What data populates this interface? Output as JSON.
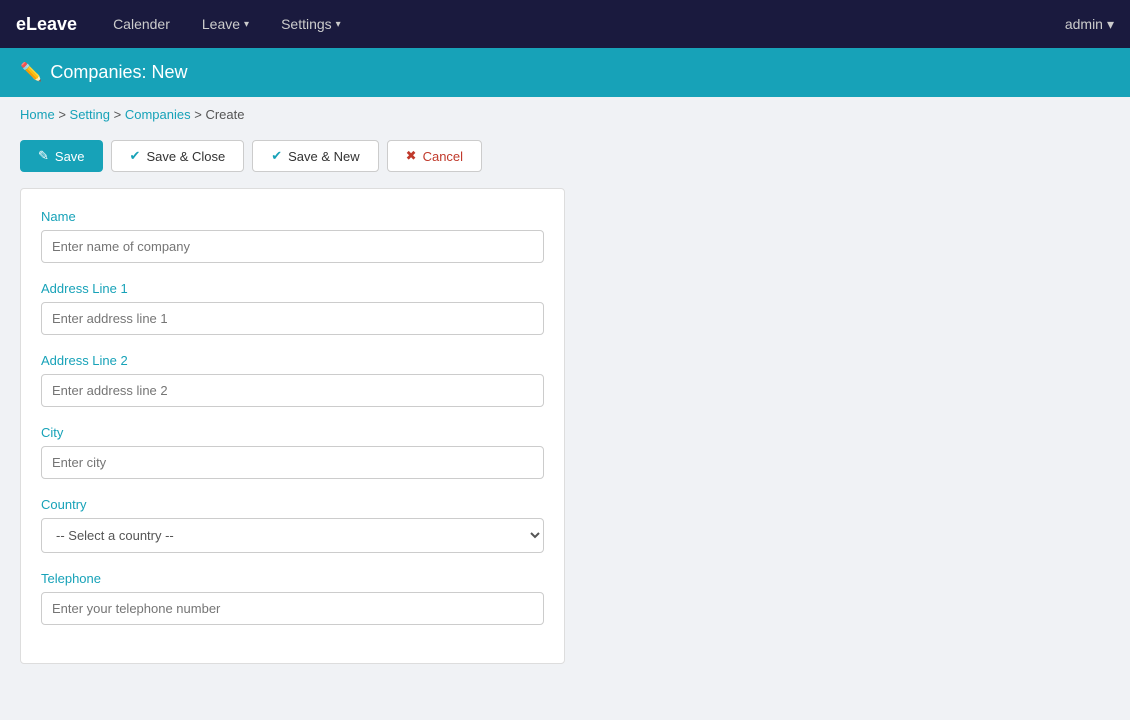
{
  "navbar": {
    "brand": "eLeave",
    "nav_items": [
      {
        "label": "Calender",
        "has_dropdown": false
      },
      {
        "label": "Leave",
        "has_dropdown": true
      },
      {
        "label": "Settings",
        "has_dropdown": true
      }
    ],
    "user": "admin"
  },
  "page_header": {
    "icon": "✏️",
    "title": "Companies: New"
  },
  "breadcrumb": {
    "items": [
      "Home",
      "Setting",
      "Companies",
      "Create"
    ],
    "separators": [
      ">",
      ">",
      ">"
    ]
  },
  "toolbar": {
    "save_label": "Save",
    "save_close_label": "Save & Close",
    "save_new_label": "Save & New",
    "cancel_label": "Cancel"
  },
  "form": {
    "name_label": "Name",
    "name_placeholder": "Enter name of company",
    "address1_label": "Address Line 1",
    "address1_placeholder": "Enter address line 1",
    "address2_label": "Address Line 2",
    "address2_placeholder": "Enter address line 2",
    "city_label": "City",
    "city_placeholder": "Enter city",
    "country_label": "Country",
    "country_placeholder": "-- Select a country --",
    "telephone_label": "Telephone",
    "telephone_placeholder": "Enter your telephone number"
  }
}
